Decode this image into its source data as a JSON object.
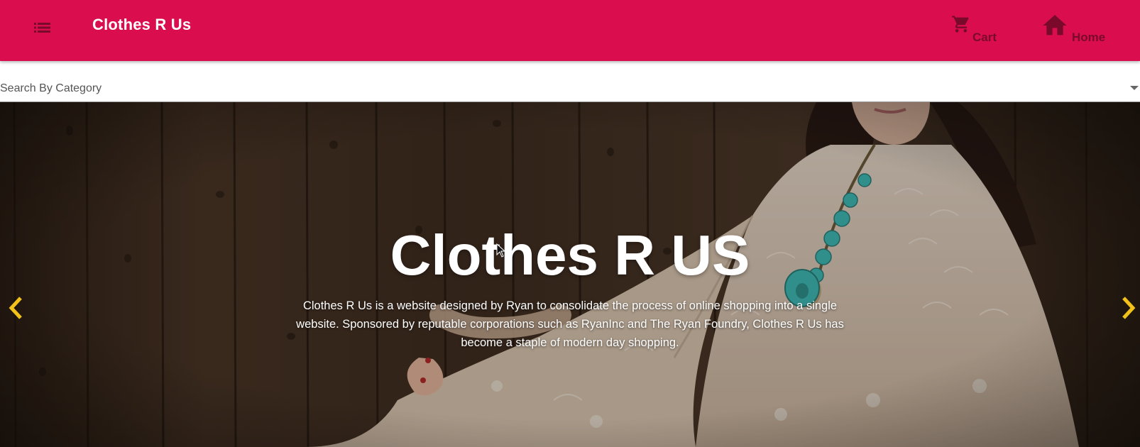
{
  "header": {
    "title": "Clothes R Us",
    "menu_icon": "list-menu-icon",
    "cart_label": "Cart",
    "cart_icon": "shopping-cart-icon",
    "home_label": "Home",
    "home_icon": "home-icon"
  },
  "category_select": {
    "label": "Search By Category"
  },
  "hero": {
    "title": "Clothes R US",
    "description": "Clothes R Us is a website designed by Ryan to consolidate the process of online shopping into a single website. Sponsored by reputable corporations such as RyanInc and The Ryan Foundry, Clothes R Us has become a staple of modern day shopping.",
    "prev_icon": "chevron-left-icon",
    "next_icon": "chevron-right-icon"
  },
  "colors": {
    "appbar": "#da0e4e",
    "appbar_icon": "#7a0a2c",
    "carousel_arrow": "#f2c21a",
    "necklace": "#3fb8b2"
  }
}
